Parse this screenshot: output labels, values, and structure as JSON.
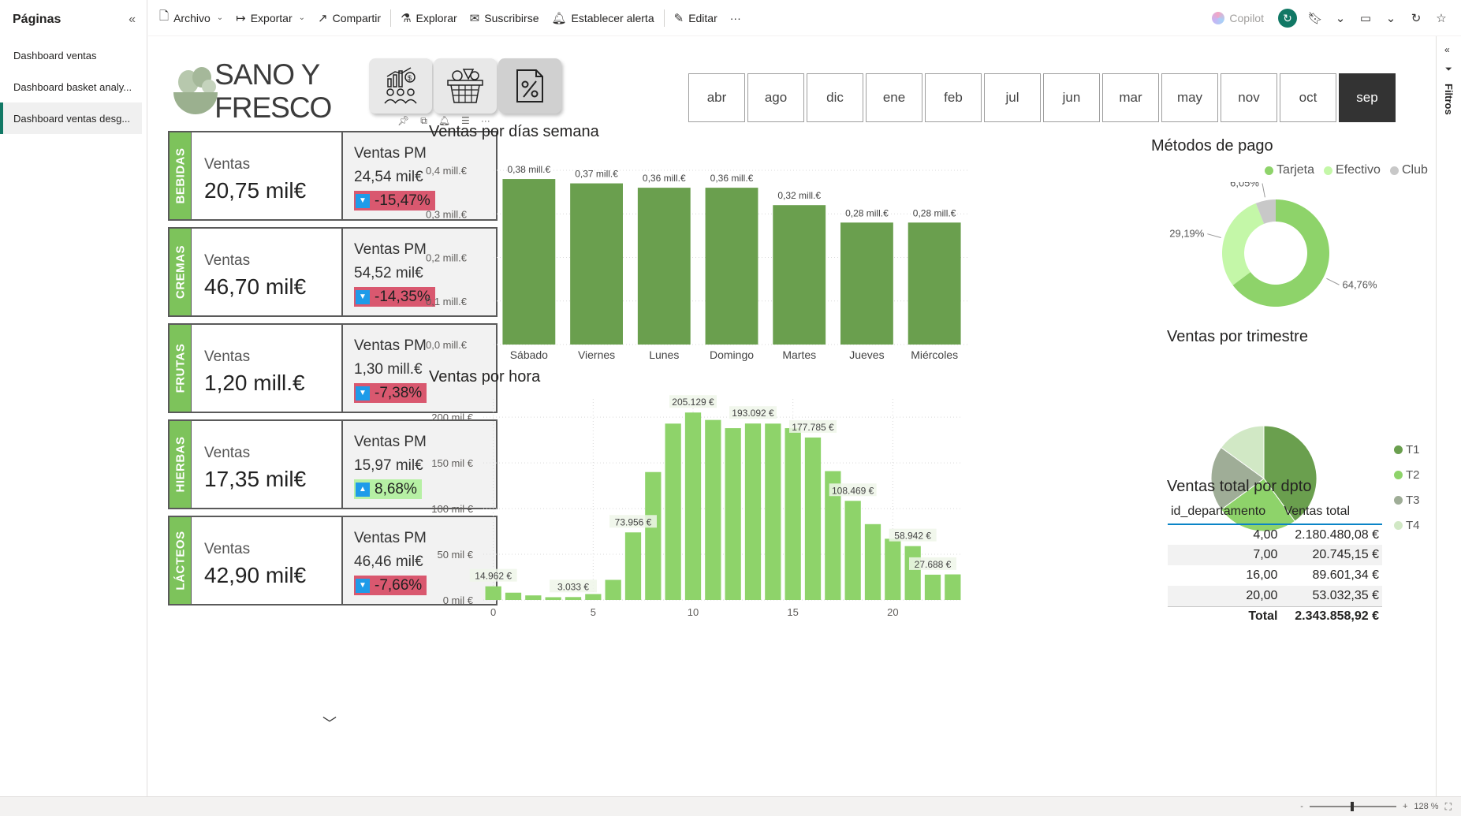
{
  "pages": {
    "title": "Páginas",
    "items": [
      {
        "label": "Dashboard ventas"
      },
      {
        "label": "Dashboard basket analy..."
      },
      {
        "label": "Dashboard ventas desg..."
      }
    ],
    "active_index": 2
  },
  "toolbar": {
    "archivo": "Archivo",
    "exportar": "Exportar",
    "compartir": "Compartir",
    "explorar": "Explorar",
    "suscribirse": "Suscribirse",
    "alerta": "Establecer alerta",
    "editar": "Editar",
    "more": "···",
    "copilot": "Copilot"
  },
  "filters_label": "Filtros",
  "status": {
    "zoom": "128 %",
    "minus": "-",
    "plus": "+"
  },
  "logo_text": "SANO Y FRESCO",
  "months": [
    "abr",
    "ago",
    "dic",
    "ene",
    "feb",
    "jul",
    "jun",
    "mar",
    "may",
    "nov",
    "oct",
    "sep"
  ],
  "selected_month": "sep",
  "kpis": [
    {
      "category": "BEBIDAS",
      "label": "Ventas",
      "value": "20,75 mil€",
      "pm_label": "Ventas PM",
      "pm_value": "24,54 mil€",
      "delta": "-15,47%",
      "direction": "down"
    },
    {
      "category": "CREMAS",
      "label": "Ventas",
      "value": "46,70 mil€",
      "pm_label": "Ventas PM",
      "pm_value": "54,52 mil€",
      "delta": "-14,35%",
      "direction": "down"
    },
    {
      "category": "FRUTAS",
      "label": "Ventas",
      "value": "1,20 mill.€",
      "pm_label": "Ventas PM",
      "pm_value": "1,30 mill.€",
      "delta": "-7,38%",
      "direction": "down"
    },
    {
      "category": "HIERBAS",
      "label": "Ventas",
      "value": "17,35 mil€",
      "pm_label": "Ventas PM",
      "pm_value": "15,97 mil€",
      "delta": "8,68%",
      "direction": "up"
    },
    {
      "category": "LÁCTEOS",
      "label": "Ventas",
      "value": "42,90 mil€",
      "pm_label": "Ventas PM",
      "pm_value": "46,46 mil€",
      "delta": "-7,66%",
      "direction": "down"
    }
  ],
  "colors": {
    "bar_dark": "#6a9f4e",
    "bar_light": "#8ed36a",
    "tab_green": "#7dc35b",
    "neg": "#d9586f",
    "pos": "#b6f0a4",
    "arrow": "#1e9be9",
    "accent": "#117865"
  },
  "table": {
    "title": "Ventas total por dpto",
    "headers": [
      "id_departamento",
      "Ventas total"
    ],
    "rows": [
      [
        "4,00",
        "2.180.480,08 €"
      ],
      [
        "7,00",
        "20.745,15 €"
      ],
      [
        "16,00",
        "89.601,34 €"
      ],
      [
        "20,00",
        "53.032,35 €"
      ]
    ],
    "total_label": "Total",
    "total_value": "2.343.858,92 €"
  },
  "chart_data": [
    {
      "type": "bar",
      "title": "Ventas por días semana",
      "categories": [
        "Sábado",
        "Viernes",
        "Lunes",
        "Domingo",
        "Martes",
        "Jueves",
        "Miércoles"
      ],
      "values": [
        0.38,
        0.37,
        0.36,
        0.36,
        0.32,
        0.28,
        0.28
      ],
      "data_labels": [
        "0,38 mill.€",
        "0,37 mill.€",
        "0,36 mill.€",
        "0,36 mill.€",
        "0,32 mill.€",
        "0,28 mill.€",
        "0,28 mill.€"
      ],
      "yticks": [
        "0,0 mill.€",
        "0,1 mill.€",
        "0,2 mill.€",
        "0,3 mill.€",
        "0,4 mill.€"
      ],
      "ylim": [
        0,
        0.4
      ],
      "grid": true
    },
    {
      "type": "bar",
      "title": "Ventas por hora",
      "x": [
        0,
        1,
        2,
        3,
        4,
        5,
        6,
        7,
        8,
        9,
        10,
        11,
        12,
        13,
        14,
        15,
        16,
        17,
        18,
        19,
        20,
        21,
        22,
        23
      ],
      "values": [
        14962,
        8000,
        5000,
        3033,
        3200,
        6500,
        22000,
        73956,
        140000,
        193000,
        205129,
        197000,
        188000,
        193092,
        193000,
        188000,
        177785,
        141000,
        108469,
        83000,
        67000,
        58942,
        27688,
        28000
      ],
      "data_labels": [
        {
          "index": 0,
          "text": "14.962 €"
        },
        {
          "index": 4,
          "text": "3.033 €"
        },
        {
          "index": 7,
          "text": "73.956 €"
        },
        {
          "index": 10,
          "text": "205.129 €"
        },
        {
          "index": 13,
          "text": "193.092 €"
        },
        {
          "index": 16,
          "text": "177.785 €"
        },
        {
          "index": 18,
          "text": "108.469 €"
        },
        {
          "index": 21,
          "text": "58.942 €"
        },
        {
          "index": 22,
          "text": "27.688 €"
        }
      ],
      "yticks": [
        "0 mil €",
        "50 mil €",
        "100 mil €",
        "150 mil €",
        "200 mil €"
      ],
      "xticks": [
        0,
        5,
        10,
        15,
        20
      ],
      "ylim": [
        0,
        220000
      ],
      "grid": true
    },
    {
      "type": "pie",
      "donut": true,
      "title": "Métodos de pago",
      "categories": [
        "Tarjeta",
        "Efectivo",
        "Club"
      ],
      "values": [
        64.76,
        29.19,
        6.05
      ],
      "data_labels": [
        "64,76%",
        "29,19%",
        "6,05%"
      ],
      "colors": [
        "#8ed36a",
        "#c4f7a8",
        "#c8c8c8"
      ],
      "legend": "top"
    },
    {
      "type": "pie",
      "title": "Ventas por trimestre",
      "categories": [
        "T1",
        "T2",
        "T3",
        "T4"
      ],
      "values": [
        40,
        25,
        20,
        15
      ],
      "colors": [
        "#6a9f4e",
        "#8ed36a",
        "#9fad97",
        "#d1e8c5"
      ],
      "legend": "right"
    }
  ]
}
